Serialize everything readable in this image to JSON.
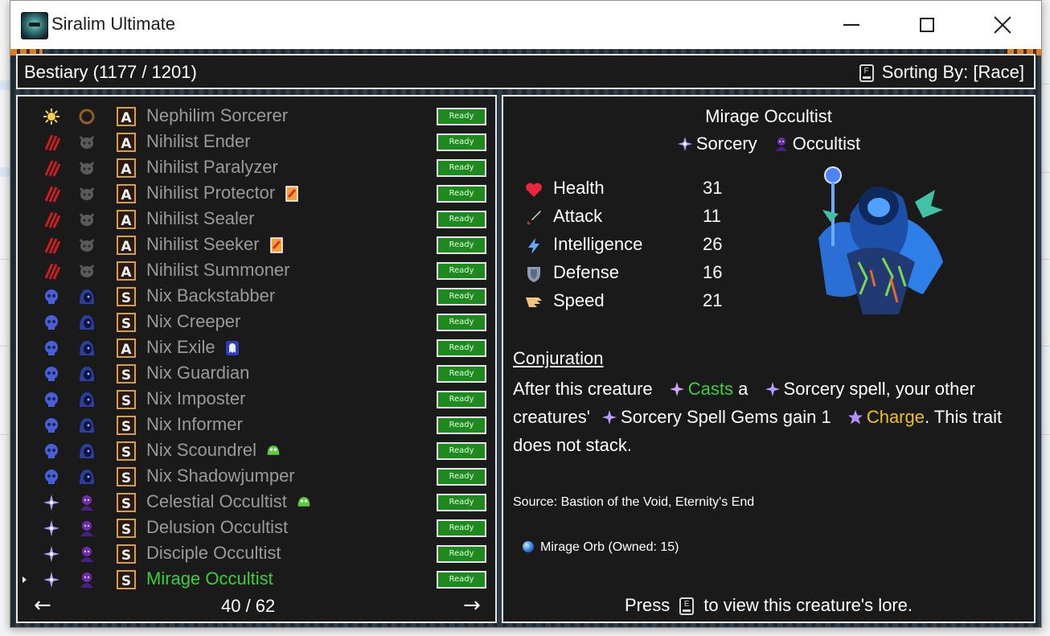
{
  "window": {
    "title": "Siralim Ultimate"
  },
  "header": {
    "title": "Bestiary (1177 / 1201)",
    "sort_key": "F",
    "sort_label": "Sorting By: [Race]"
  },
  "list": {
    "items": [
      {
        "name": "Nephilim Sorcerer",
        "race_icon": "sun-icon",
        "class_icon": "ring-icon",
        "rank": "A",
        "status": "Ready",
        "badge": ""
      },
      {
        "name": "Nihilist Ender",
        "race_icon": "claw-icon",
        "class_icon": "beast-icon",
        "rank": "A",
        "status": "Ready",
        "badge": ""
      },
      {
        "name": "Nihilist Paralyzer",
        "race_icon": "claw-icon",
        "class_icon": "beast-icon",
        "rank": "A",
        "status": "Ready",
        "badge": ""
      },
      {
        "name": "Nihilist Protector",
        "race_icon": "claw-icon",
        "class_icon": "beast-icon",
        "rank": "A",
        "status": "Ready",
        "badge": "card-icon"
      },
      {
        "name": "Nihilist Sealer",
        "race_icon": "claw-icon",
        "class_icon": "beast-icon",
        "rank": "A",
        "status": "Ready",
        "badge": ""
      },
      {
        "name": "Nihilist Seeker",
        "race_icon": "claw-icon",
        "class_icon": "beast-icon",
        "rank": "A",
        "status": "Ready",
        "badge": "card-icon"
      },
      {
        "name": "Nihilist Summoner",
        "race_icon": "claw-icon",
        "class_icon": "beast-icon",
        "rank": "A",
        "status": "Ready",
        "badge": ""
      },
      {
        "name": "Nix Backstabber",
        "race_icon": "skull-icon",
        "class_icon": "hood-icon",
        "rank": "S",
        "status": "Ready",
        "badge": ""
      },
      {
        "name": "Nix Creeper",
        "race_icon": "skull-icon",
        "class_icon": "hood-icon",
        "rank": "S",
        "status": "Ready",
        "badge": ""
      },
      {
        "name": "Nix Exile",
        "race_icon": "skull-icon",
        "class_icon": "hood-icon",
        "rank": "A",
        "status": "Ready",
        "badge": "ghost-icon"
      },
      {
        "name": "Nix Guardian",
        "race_icon": "skull-icon",
        "class_icon": "hood-icon",
        "rank": "S",
        "status": "Ready",
        "badge": ""
      },
      {
        "name": "Nix Imposter",
        "race_icon": "skull-icon",
        "class_icon": "hood-icon",
        "rank": "S",
        "status": "Ready",
        "badge": ""
      },
      {
        "name": "Nix Informer",
        "race_icon": "skull-icon",
        "class_icon": "hood-icon",
        "rank": "S",
        "status": "Ready",
        "badge": ""
      },
      {
        "name": "Nix Scoundrel",
        "race_icon": "skull-icon",
        "class_icon": "hood-icon",
        "rank": "S",
        "status": "Ready",
        "badge": "slime-icon"
      },
      {
        "name": "Nix Shadowjumper",
        "race_icon": "skull-icon",
        "class_icon": "hood-icon",
        "rank": "S",
        "status": "Ready",
        "badge": ""
      },
      {
        "name": "Celestial Occultist",
        "race_icon": "sparkle-icon",
        "class_icon": "occult-icon",
        "rank": "S",
        "status": "Ready",
        "badge": "slime-icon"
      },
      {
        "name": "Delusion Occultist",
        "race_icon": "sparkle-icon",
        "class_icon": "occult-icon",
        "rank": "S",
        "status": "Ready",
        "badge": ""
      },
      {
        "name": "Disciple Occultist",
        "race_icon": "sparkle-icon",
        "class_icon": "occult-icon",
        "rank": "S",
        "status": "Ready",
        "badge": ""
      },
      {
        "name": "Mirage Occultist",
        "race_icon": "sparkle-icon",
        "class_icon": "occult-icon",
        "rank": "S",
        "status": "Ready",
        "badge": "",
        "selected": true
      }
    ],
    "pager": {
      "text": "40 / 62",
      "prev": "←",
      "next": "→"
    }
  },
  "detail": {
    "name": "Mirage Occultist",
    "class": "Sorcery",
    "race": "Occultist",
    "stats": [
      {
        "label": "Health",
        "value": "31",
        "icon": "heart-icon"
      },
      {
        "label": "Attack",
        "value": "11",
        "icon": "sword-icon"
      },
      {
        "label": "Intelligence",
        "value": "26",
        "icon": "lightning-icon"
      },
      {
        "label": "Defense",
        "value": "16",
        "icon": "shield-icon"
      },
      {
        "label": "Speed",
        "value": "21",
        "icon": "wing-icon"
      }
    ],
    "trait": {
      "title": "Conjuration",
      "t1": "After this creature",
      "t2": "Casts",
      "t3": "a",
      "t4": "Sorcery spell, your other creatures'",
      "t5": "Sorcery Spell Gems gain 1",
      "t6": "Charge",
      "t7": ". This trait does not stack."
    },
    "source": "Source: Bastion of the Void, Eternity's End",
    "orb": "Mirage Orb (Owned: 15)",
    "lore": {
      "pre": "Press",
      "key": "E",
      "post": "to view this creature's lore."
    }
  },
  "colors": {
    "selected_text": "#3ccf3c",
    "ready_bg": "#1e8a1e",
    "charge": "#f0c020"
  }
}
